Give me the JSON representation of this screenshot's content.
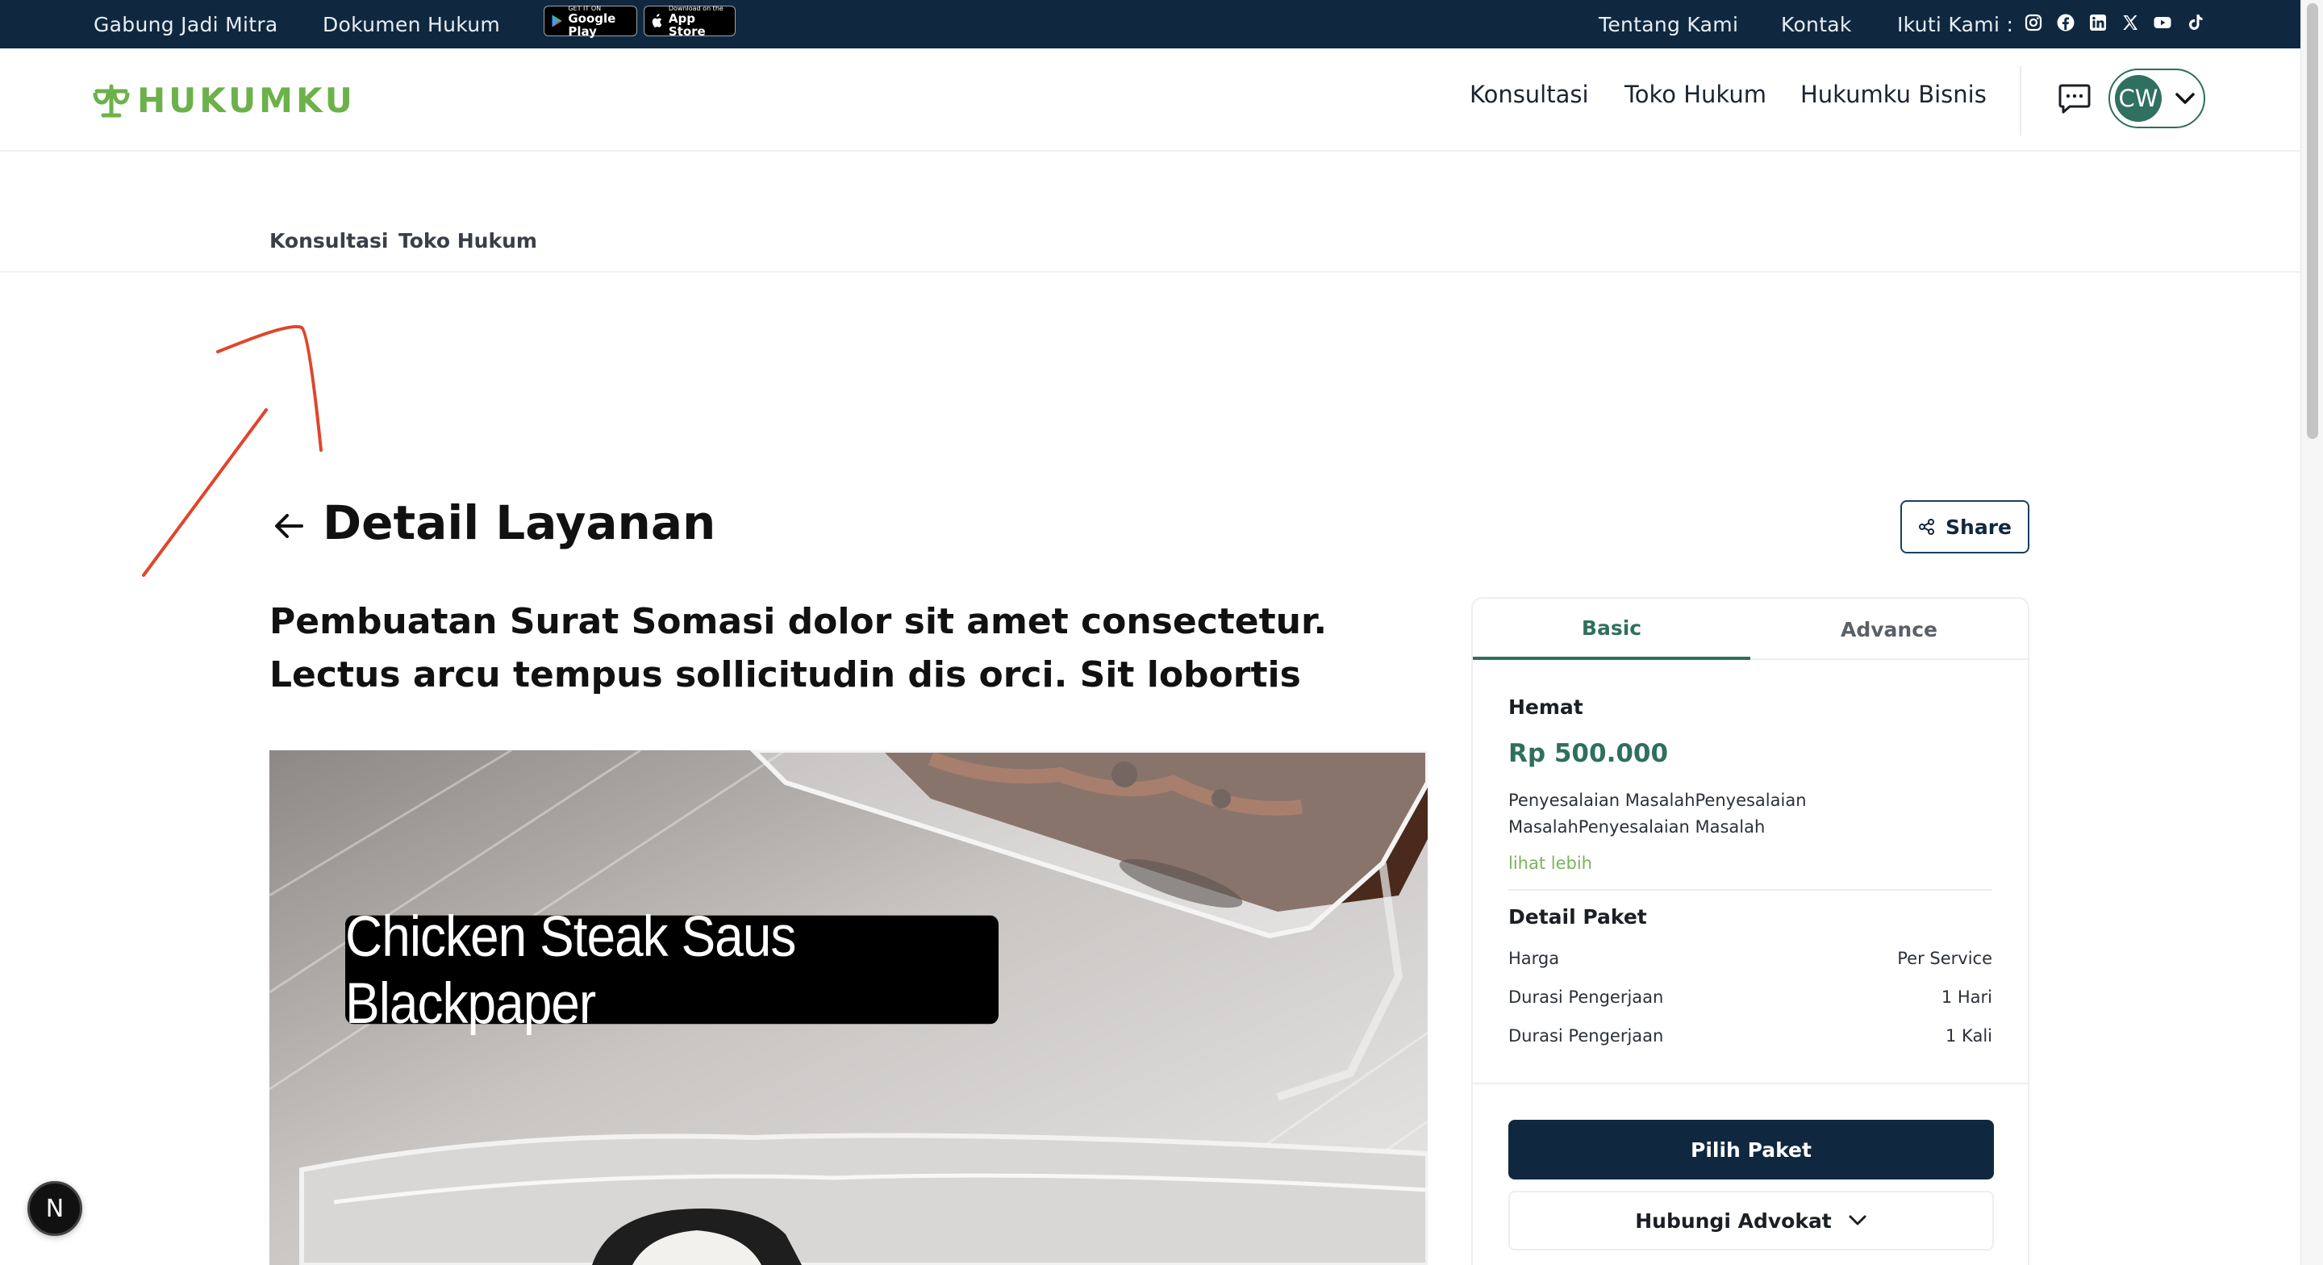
{
  "topbar": {
    "left_links": [
      "Gabung Jadi Mitra",
      "Dokumen Hukum"
    ],
    "google_play": {
      "small": "GET IT ON",
      "big": "Google Play"
    },
    "app_store": {
      "small": "Download on the",
      "big": "App Store"
    },
    "right_links": [
      "Tentang Kami",
      "Kontak"
    ],
    "follow_label": "Ikuti Kami :",
    "social_icons": [
      "instagram-icon",
      "facebook-icon",
      "linkedin-icon",
      "x-icon",
      "youtube-icon",
      "tiktok-icon"
    ],
    "bg_color": "#0f2840"
  },
  "header": {
    "logo_text": "HUKUMKU",
    "nav": [
      "Konsultasi",
      "Toko Hukum",
      "Hukumku Bisnis"
    ],
    "avatar_initials": "CW",
    "brand_color": "#6cb14a"
  },
  "subnav": [
    "Konsultasi",
    "Toko Hukum"
  ],
  "page": {
    "title": "Detail Layanan",
    "share_label": "Share",
    "service_title": "Pembuatan Surat Somasi dolor sit amet consectetur. Lectus arcu tempus sollicitudin dis orci. Sit lobortis",
    "photo_caption": "Chicken Steak Saus Blackpaper"
  },
  "package": {
    "tabs": [
      "Basic",
      "Advance"
    ],
    "active_tab": "Basic",
    "name": "Hemat",
    "price": "Rp 500.000",
    "description": "Penyesalaian MasalahPenyesalaian MasalahPenyesalaian Masalah",
    "see_more": "lihat lebih",
    "detail_title": "Detail Paket",
    "details": [
      {
        "label": "Harga",
        "value": "Per Service"
      },
      {
        "label": "Durasi Pengerjaan",
        "value": "1 Hari"
      },
      {
        "label": "Durasi Pengerjaan",
        "value": "1 Kali"
      }
    ],
    "choose_label": "Pilih Paket",
    "contact_label": "Hubungi Advokat",
    "accent_color": "#2f6f5e"
  },
  "floating": {
    "label": "N"
  }
}
